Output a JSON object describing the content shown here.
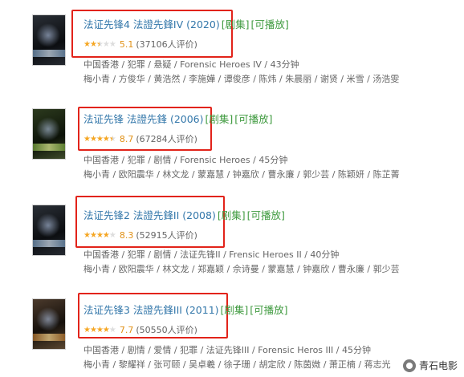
{
  "items": [
    {
      "title": "法证先锋4 法證先鋒IV (2020)",
      "tag_series": "[剧集]",
      "tag_play": "[可播放]",
      "stars": [
        1,
        1,
        0.5,
        0,
        0
      ],
      "score": "5.1",
      "votes": "(37106人评价)",
      "info": "中国香港 / 犯罪 / 悬疑 / Forensic Heroes IV / 43分钟",
      "cast": "梅小青 / 方俊华 / 黄浩然 / 李施嬅 / 谭俊彦 / 陈炜 / 朱晨丽 / 谢贤 / 米雪 / 汤浩雯"
    },
    {
      "title": "法证先锋 法證先鋒 (2006)",
      "tag_series": "[剧集]",
      "tag_play": "[可播放]",
      "stars": [
        1,
        1,
        1,
        1,
        0.5
      ],
      "score": "8.7",
      "votes": "(67284人评价)",
      "info": "中国香港 / 犯罪 / 剧情 / Forensic Heroes / 45分钟",
      "cast": "梅小青 / 欧阳震华 / 林文龙 / 蒙嘉慧 / 钟嘉欣 / 曹永廉 / 郭少芸 / 陈颖妍 / 陈芷菁"
    },
    {
      "title": "法证先锋2 法證先鋒II (2008)",
      "tag_series": "[剧集]",
      "tag_play": "[可播放]",
      "stars": [
        1,
        1,
        1,
        1,
        0
      ],
      "score": "8.3",
      "votes": "(52915人评价)",
      "info": "中国香港 / 犯罪 / 剧情 / 法证先锋II / Frensic Heroes II / 40分钟",
      "cast": "梅小青 / 欧阳震华 / 林文龙 / 郑嘉颖 / 佘诗曼 / 蒙嘉慧 / 钟嘉欣 / 曹永廉 / 郭少芸"
    },
    {
      "title": "法证先锋3 法證先鋒III (2011)",
      "tag_series": "[剧集]",
      "tag_play": "[可播放]",
      "stars": [
        1,
        1,
        1,
        1,
        0
      ],
      "score": "7.7",
      "votes": "(50550人评价)",
      "info": "中国香港 / 剧情 / 爱情 / 犯罪 / 法证先锋III / Forensic Heros III / 45分钟",
      "cast": "梅小青 / 黎耀祥 / 张可颐 / 吴卓羲 / 徐子珊 / 胡定欣 / 陈茵媺 / 萧正楠 / 蒋志光"
    }
  ],
  "watermark": "青石电影",
  "colors": {
    "link": "#3377aa",
    "tag": "#3f9a3f",
    "star": "#f5a623",
    "highlight": "#e2231a"
  }
}
